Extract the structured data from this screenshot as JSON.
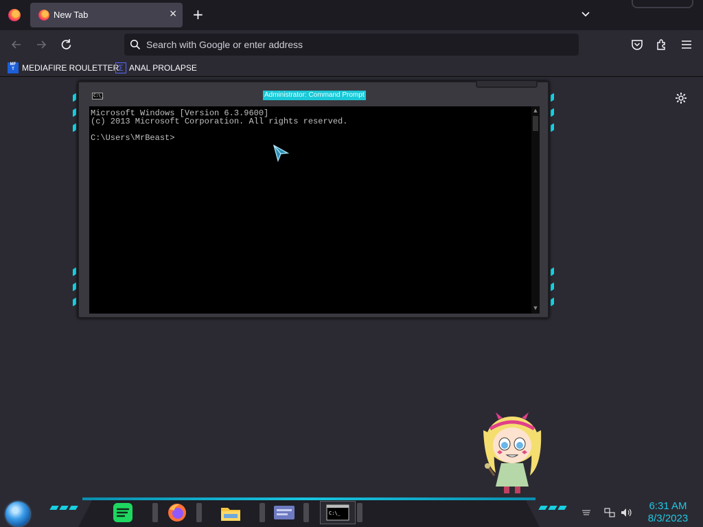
{
  "browser": {
    "tab": {
      "label": "New Tab",
      "close_glyph": "×"
    },
    "new_tab_glyph": "+",
    "urlbar": {
      "placeholder": "Search with Google or enter address",
      "value": ""
    },
    "bookmarks": [
      {
        "label": "MEDIAFIRE ROULETTER",
        "icon_text": "MF\nT"
      },
      {
        "label": "ANAL PROLAPSE",
        "icon_text": "Σ"
      }
    ]
  },
  "cmd": {
    "title": "Administrator: Command Prompt",
    "icon_text": "C:\\_",
    "lines": [
      "Microsoft Windows [Version 6.3.9600]",
      "(c) 2013 Microsoft Corporation. All rights reserved.",
      "",
      "C:\\Users\\MrBeast>"
    ],
    "scroll_up": "▲",
    "scroll_down": "▼"
  },
  "taskbar": {
    "apps": [
      "spotify-icon",
      "firefox-icon",
      "file-explorer-icon",
      "control-panel-icon",
      "command-prompt-icon"
    ],
    "active_app_text": "C:\\_",
    "clock": {
      "time": "6:31 AM",
      "date": "8/3/2023"
    }
  },
  "colors": {
    "accent": "#17d0e0",
    "chrome_dark": "#1c1b22",
    "chrome": "#2b2a33",
    "clock": "#1fc8e0"
  }
}
